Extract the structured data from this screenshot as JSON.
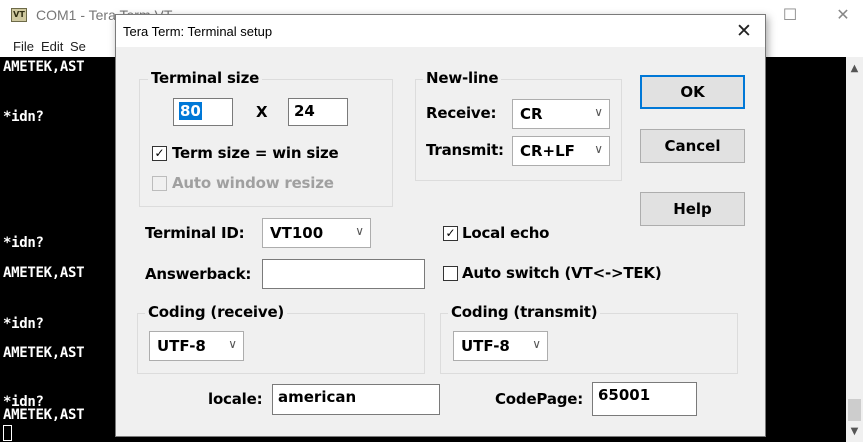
{
  "background_window": {
    "title": "COM1 - Tera Term VT",
    "app_icon_text": "VT",
    "menu": [
      "File",
      "Edit",
      "Se"
    ],
    "terminal_lines": [
      "AMETEK,AST",
      "*idn?",
      "*idn?",
      "AMETEK,AST",
      "*idn?",
      "AMETEK,AST",
      "*idn?",
      "AMETEK,AST"
    ]
  },
  "dialog": {
    "title": "Tera Term: Terminal setup",
    "terminal_size": {
      "label": "Terminal size",
      "width": "80",
      "times": "X",
      "height": "24",
      "term_size_win_size": "Term size = win size",
      "auto_window_resize": "Auto window resize"
    },
    "newline": {
      "label": "New-line",
      "receive_label": "Receive:",
      "receive_value": "CR",
      "transmit_label": "Transmit:",
      "transmit_value": "CR+LF"
    },
    "buttons": {
      "ok": "OK",
      "cancel": "Cancel",
      "help": "Help"
    },
    "terminal_id": {
      "label": "Terminal ID:",
      "value": "VT100"
    },
    "local_echo": "Local echo",
    "answerback": {
      "label": "Answerback:",
      "value": ""
    },
    "auto_switch": "Auto switch (VT<->TEK)",
    "coding_receive": {
      "label": "Coding (receive)",
      "value": "UTF-8"
    },
    "coding_transmit": {
      "label": "Coding (transmit)",
      "value": "UTF-8"
    },
    "locale": {
      "label": "locale:",
      "value": "american"
    },
    "codepage": {
      "label": "CodePage:",
      "value": "65001"
    }
  },
  "checkmark_glyph": "✓",
  "colors": {
    "accent": "#0078d7",
    "dialog_bg": "#f0f0f0",
    "terminal_bg": "#000000"
  }
}
